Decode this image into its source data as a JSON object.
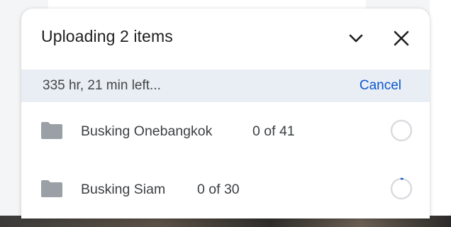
{
  "upload_panel": {
    "title": "Uploading 2 items",
    "status": "335 hr, 21 min left...",
    "cancel_label": "Cancel",
    "icons": {
      "collapse": "chevron-down-icon",
      "close": "close-icon",
      "folder": "folder-icon",
      "progress": "progress-ring-icon"
    },
    "items": [
      {
        "name": "Busking Onebangkok",
        "progress": "0 of 41",
        "done_fraction": 0
      },
      {
        "name": "Busking Siam",
        "progress": "0 of 30",
        "done_fraction": 0
      }
    ]
  },
  "colors": {
    "title": "#1f1f1f",
    "status_bar_bg": "#e9edf4",
    "link": "#0b57d0",
    "icon_gray": "#9aa0a6",
    "ring_gray": "#dadce0",
    "ring_progress": "#0b57d0"
  }
}
